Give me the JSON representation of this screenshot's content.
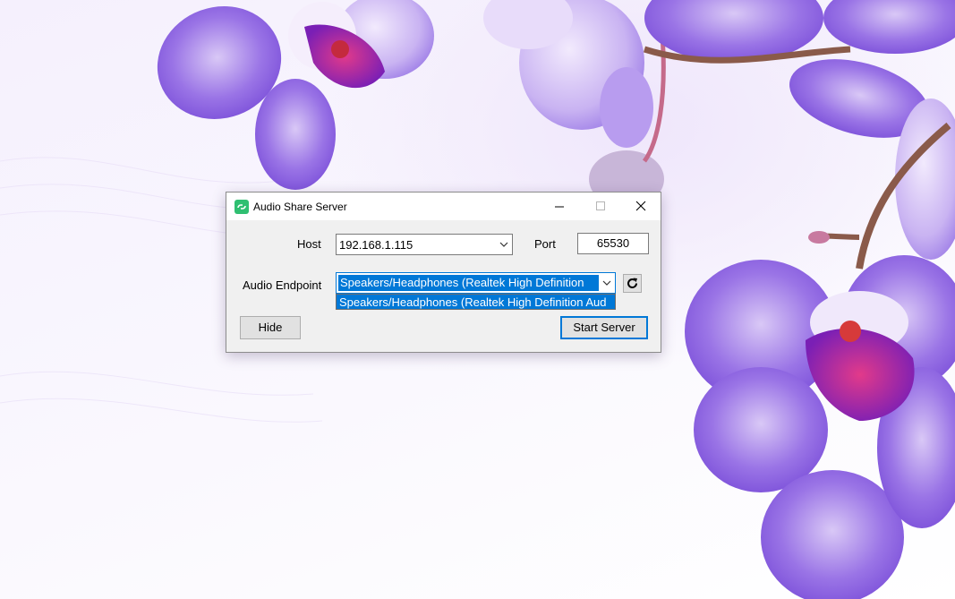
{
  "window": {
    "title": "Audio Share Server",
    "icon": "audio-share-icon"
  },
  "form": {
    "host_label": "Host",
    "host_value": "192.168.1.115",
    "port_label": "Port",
    "port_value": "65530",
    "endpoint_label": "Audio Endpoint",
    "endpoint_value": "Speakers/Headphones (Realtek High Definition",
    "endpoint_options": [
      "Speakers/Headphones (Realtek High Definition Aud"
    ]
  },
  "buttons": {
    "hide": "Hide",
    "start": "Start Server",
    "refresh_icon": "refresh-icon"
  },
  "colors": {
    "accent": "#0078d7",
    "app_icon": "#2fbf71",
    "orchid": "#8a5ce0"
  }
}
